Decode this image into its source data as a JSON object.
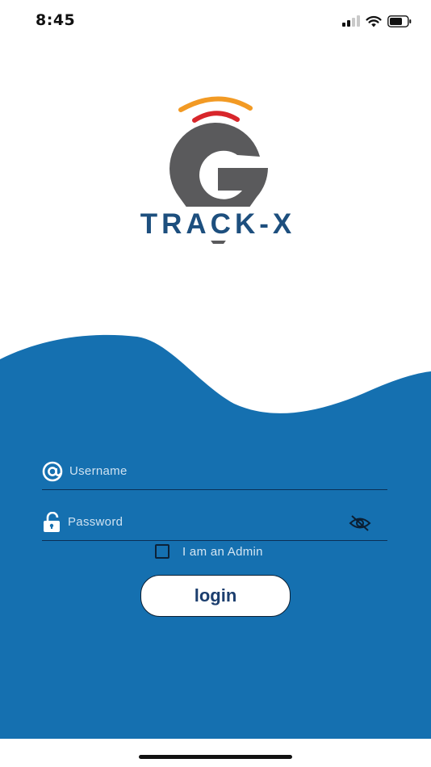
{
  "status_bar": {
    "time": "8:45"
  },
  "brand": {
    "name": "TRACK-X",
    "logo_letter_color": "#5a5a5c",
    "text_color": "#1d4f7e",
    "signal_colors": [
      "#f29a24",
      "#d8262b",
      "#7bbf3c"
    ]
  },
  "form": {
    "username": {
      "placeholder": "Username",
      "value": "",
      "icon": "at-icon"
    },
    "password": {
      "placeholder": "Password",
      "value": "",
      "icon": "unlocked-padlock-icon",
      "toggle_icon": "eye-off-icon"
    },
    "admin_checkbox": {
      "label": "I am an Admin",
      "checked": false
    },
    "login_button": {
      "label": "login"
    }
  },
  "colors": {
    "background": "#ffffff",
    "wave": "#1570b0",
    "field_line": "#0b2f55",
    "button_text": "#1c3e6e"
  }
}
